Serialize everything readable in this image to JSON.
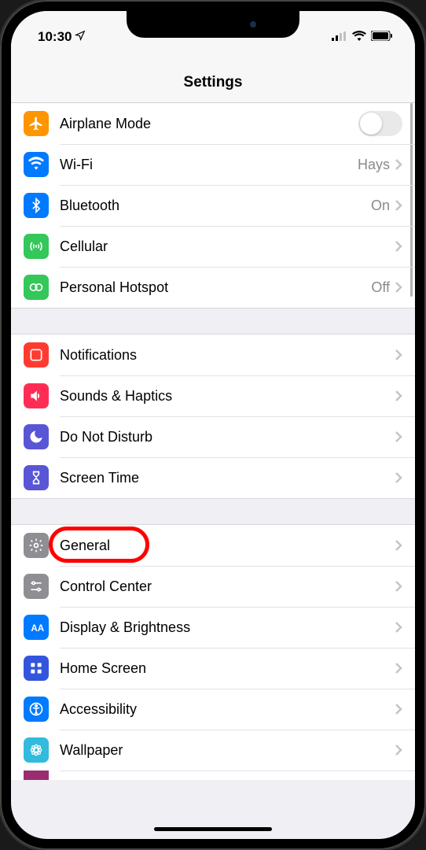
{
  "status": {
    "time": "10:30",
    "location_icon": "location-arrow",
    "cellular": "weak",
    "wifi": "on",
    "battery": "full"
  },
  "header": {
    "title": "Settings"
  },
  "groups": [
    {
      "id": "connectivity",
      "rows": [
        {
          "id": "airplane",
          "icon": "airplane-icon",
          "color": "#ff9500",
          "label": "Airplane Mode",
          "control": "toggle",
          "toggle_on": false
        },
        {
          "id": "wifi",
          "icon": "wifi-icon",
          "color": "#007aff",
          "label": "Wi-Fi",
          "value": "Hays",
          "control": "disclosure"
        },
        {
          "id": "bluetooth",
          "icon": "bluetooth-icon",
          "color": "#007aff",
          "label": "Bluetooth",
          "value": "On",
          "control": "disclosure"
        },
        {
          "id": "cellular",
          "icon": "cellular-icon",
          "color": "#34c759",
          "label": "Cellular",
          "control": "disclosure"
        },
        {
          "id": "hotspot",
          "icon": "hotspot-icon",
          "color": "#34c759",
          "label": "Personal Hotspot",
          "value": "Off",
          "control": "disclosure"
        }
      ]
    },
    {
      "id": "alerts",
      "rows": [
        {
          "id": "notifications",
          "icon": "notifications-icon",
          "color": "#ff3b30",
          "label": "Notifications",
          "control": "disclosure",
          "badge": true
        },
        {
          "id": "sounds",
          "icon": "sounds-icon",
          "color": "#ff2d55",
          "label": "Sounds & Haptics",
          "control": "disclosure"
        },
        {
          "id": "dnd",
          "icon": "moon-icon",
          "color": "#5856d6",
          "label": "Do Not Disturb",
          "control": "disclosure"
        },
        {
          "id": "screentime",
          "icon": "hourglass-icon",
          "color": "#5856d6",
          "label": "Screen Time",
          "control": "disclosure"
        }
      ]
    },
    {
      "id": "system",
      "rows": [
        {
          "id": "general",
          "icon": "gear-icon",
          "color": "#8e8e93",
          "label": "General",
          "control": "disclosure",
          "highlight": true
        },
        {
          "id": "controlcenter",
          "icon": "controlcenter-icon",
          "color": "#8e8e93",
          "label": "Control Center",
          "control": "disclosure"
        },
        {
          "id": "display",
          "icon": "display-icon",
          "color": "#007aff",
          "label": "Display & Brightness",
          "control": "disclosure"
        },
        {
          "id": "homescreen",
          "icon": "homescreen-icon",
          "color": "#3355dd",
          "label": "Home Screen",
          "control": "disclosure"
        },
        {
          "id": "accessibility",
          "icon": "accessibility-icon",
          "color": "#007aff",
          "label": "Accessibility",
          "control": "disclosure"
        },
        {
          "id": "wallpaper",
          "icon": "wallpaper-icon",
          "color": "#33bbdd",
          "label": "Wallpaper",
          "control": "disclosure"
        }
      ]
    }
  ],
  "annotation": {
    "highlight_target": "general"
  }
}
